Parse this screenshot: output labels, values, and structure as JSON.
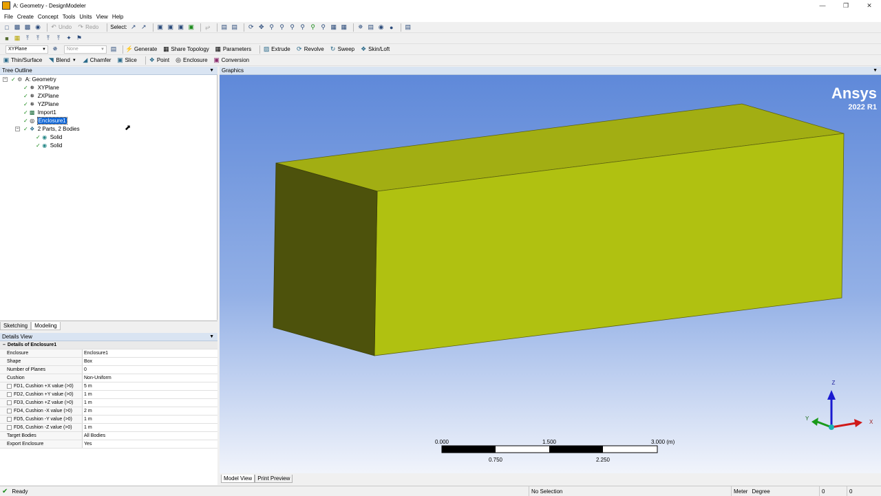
{
  "window": {
    "title": "A: Geometry - DesignModeler"
  },
  "menu": [
    "File",
    "Create",
    "Concept",
    "Tools",
    "Units",
    "View",
    "Help"
  ],
  "toolbar1": {
    "undo": "Undo",
    "redo": "Redo",
    "select": "Select:"
  },
  "toolbar3": {
    "plane": "XYPlane",
    "sketch": "None",
    "generate": "Generate",
    "share_topology": "Share Topology",
    "parameters": "Parameters",
    "extrude": "Extrude",
    "revolve": "Revolve",
    "sweep": "Sweep",
    "skin_loft": "Skin/Loft"
  },
  "toolbar4": {
    "thin_surface": "Thin/Surface",
    "blend": "Blend",
    "chamfer": "Chamfer",
    "slice": "Slice",
    "point": "Point",
    "enclosure": "Enclosure",
    "conversion": "Conversion"
  },
  "tree": {
    "header": "Tree Outline",
    "root": "A: Geometry",
    "items": [
      {
        "label": "XYPlane",
        "icon": "plane-icon"
      },
      {
        "label": "ZXPlane",
        "icon": "plane-icon"
      },
      {
        "label": "YZPlane",
        "icon": "plane-icon"
      },
      {
        "label": "Import1",
        "icon": "import-icon"
      },
      {
        "label": "Enclosure1",
        "icon": "enclosure-icon"
      }
    ],
    "parts": "2 Parts, 2 Bodies",
    "bodies": [
      "Solid",
      "Solid"
    ]
  },
  "mode_tabs": [
    "Sketching",
    "Modeling"
  ],
  "details": {
    "header": "Details View",
    "section": "Details of Enclosure1",
    "rows": [
      {
        "key": "Enclosure",
        "value": "Enclosure1"
      },
      {
        "key": "Shape",
        "value": "Box"
      },
      {
        "key": "Number of Planes",
        "value": "0"
      },
      {
        "key": "Cushion",
        "value": "Non-Uniform"
      },
      {
        "key": "FD1, Cushion +X value (>0)",
        "value": "5 m"
      },
      {
        "key": "FD2, Cushion +Y value (>0)",
        "value": "1 m"
      },
      {
        "key": "FD3, Cushion +Z value (>0)",
        "value": "1 m"
      },
      {
        "key": "FD4, Cushion -X value (>0)",
        "value": "2 m"
      },
      {
        "key": "FD5, Cushion -Y value (>0)",
        "value": "1 m"
      },
      {
        "key": "FD6, Cushion -Z value (>0)",
        "value": "1 m"
      },
      {
        "key": "Target Bodies",
        "value": "All Bodies"
      },
      {
        "key": "Export Enclosure",
        "value": "Yes"
      }
    ]
  },
  "graphics": {
    "header": "Graphics",
    "brand": "Ansys",
    "version": "2022 R1",
    "scale_labels_top": [
      "0.000",
      "1.500",
      "3.000 (m)"
    ],
    "scale_labels_bottom": [
      "0.750",
      "2.250"
    ],
    "axes": {
      "x": "X",
      "y": "Y",
      "z": "Z"
    },
    "colors": {
      "box_top": "#a2ae13",
      "box_front": "#b0c111",
      "box_side": "#4d520c"
    }
  },
  "bottom_tabs": [
    "Model View",
    "Print Preview"
  ],
  "status": {
    "ready": "Ready",
    "selection": "No Selection",
    "units_length": "Meter",
    "units_angle": "Degree",
    "val1": "0",
    "val2": "0"
  }
}
